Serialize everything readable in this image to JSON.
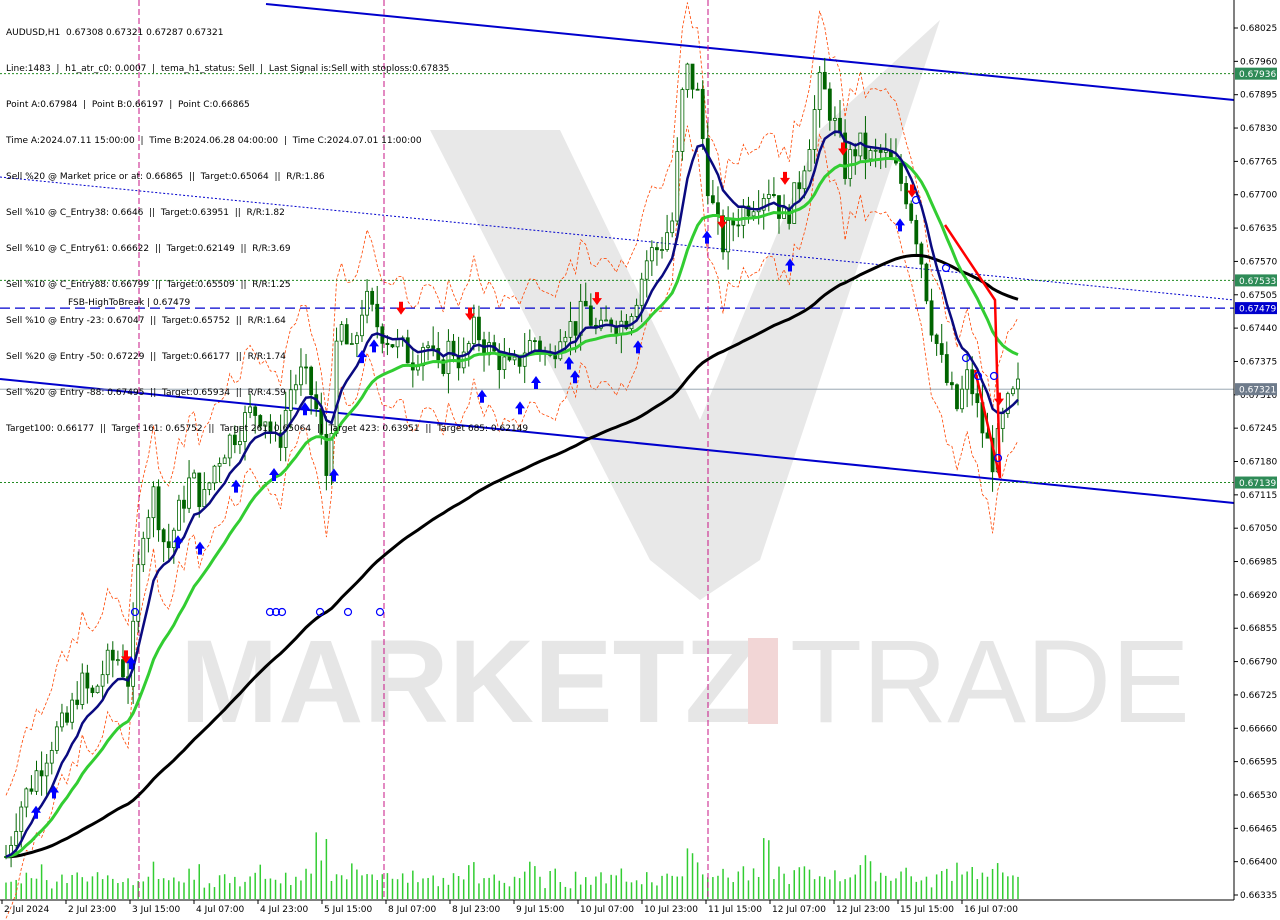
{
  "header": {
    "symbol_line": "AUDUSD,H1  0.67308 0.67321 0.67287 0.67321",
    "info_lines": [
      "Line:1483  |  h1_atr_c0: 0.0007  |  tema_h1_status: Sell  |  Last Signal is:Sell with stoploss:0.67835",
      "Point A:0.67984  |  Point B:0.66197  |  Point C:0.66865",
      "Time A:2024.07.11 15:00:00  |  Time B:2024.06.28 04:00:00  |  Time C:2024.07.01 11:00:00",
      "Sell %20 @ Market price or at: 0.66865  ||  Target:0.65064  ||  R/R:1.86",
      "Sell %10 @ C_Entry38: 0.6646  ||  Target:0.63951  ||  R/R:1.82",
      "Sell %10 @ C_Entry61: 0.66622  ||  Target:0.62149  ||  R/R:3.69",
      "Sell %10 @ C_Entry88: 0.66799  ||  Target:0.65509  ||  R/R:1.25",
      "Sell %10 @ Entry -23: 0.67047  ||  Target:0.65752  ||  R/R:1.64",
      "Sell %20 @ Entry -50: 0.67229  ||  Target:0.66177  ||  R/R:1.74",
      "Sell %20 @ Entry -88: 0.67495  ||  Target:0.65934  ||  R/R:4.59",
      "Target100: 0.66177  ||  Target 161: 0.65752  ||  Target 261: 0.65064  ||  Target 423: 0.63951  ||  Target 685: 0.62149"
    ]
  },
  "watermark": {
    "left": "MARKETZ",
    "right": "TRADE"
  },
  "colors": {
    "candle": "#006400",
    "ema_fast": "#0a0a80",
    "ema_mid": "#32cd32",
    "ema_slow": "#000000",
    "channel": "#0000cd",
    "envelope": "#ff4500",
    "level_green": "#228b22",
    "arrow_buy": "#0000ff",
    "arrow_sell": "#ff0000",
    "session_line": "#c71585",
    "label_green_bg": "#2e8b57",
    "label_blue_bg": "#0000cd",
    "label_gray_bg": "#6e7b8b",
    "volume": "#32cd32"
  },
  "chart_data": {
    "type": "candlestick",
    "symbol": "AUDUSD",
    "timeframe": "H1",
    "ylim": [
      0.66335,
      0.68025
    ],
    "price_ticks": [
      "0.68025",
      "0.67960",
      "0.67895",
      "0.67830",
      "0.67765",
      "0.67700",
      "0.67635",
      "0.67570",
      "0.67505",
      "0.67440",
      "0.67375",
      "0.67310",
      "0.67245",
      "0.67180",
      "0.67115",
      "0.67050",
      "0.66985",
      "0.66920",
      "0.66855",
      "0.66790",
      "0.66725",
      "0.66660",
      "0.66595",
      "0.66530",
      "0.66465",
      "0.66400",
      "0.66335"
    ],
    "time_ticks": [
      "2 Jul 2024",
      "2 Jul 23:00",
      "3 Jul 15:00",
      "4 Jul 07:00",
      "4 Jul 23:00",
      "5 Jul 15:00",
      "8 Jul 07:00",
      "8 Jul 23:00",
      "9 Jul 15:00",
      "10 Jul 07:00",
      "10 Jul 23:00",
      "11 Jul 15:00",
      "12 Jul 07:00",
      "12 Jul 23:00",
      "15 Jul 15:00",
      "16 Jul 07:00"
    ],
    "close_path": [
      0.6641,
      0.665,
      0.6655,
      0.666,
      0.6665,
      0.6667,
      0.6675,
      0.6672,
      0.6678,
      0.668,
      0.6675,
      0.6705,
      0.6712,
      0.67,
      0.6708,
      0.6715,
      0.671,
      0.6718,
      0.6722,
      0.6725,
      0.6728,
      0.6727,
      0.672,
      0.6732,
      0.6735,
      0.673,
      0.6715,
      0.6745,
      0.6738,
      0.675,
      0.6745,
      0.6742,
      0.674,
      0.6738,
      0.6742,
      0.6735,
      0.6741,
      0.6737,
      0.6744,
      0.674,
      0.6738,
      0.6735,
      0.674,
      0.6742,
      0.6737,
      0.6745,
      0.6744,
      0.6748,
      0.6742,
      0.6746,
      0.6745,
      0.675,
      0.6758,
      0.676,
      0.6765,
      0.6795,
      0.679,
      0.677,
      0.676,
      0.6765,
      0.6768,
      0.677,
      0.6772,
      0.6765,
      0.677,
      0.678,
      0.6792,
      0.6785,
      0.6775,
      0.678,
      0.6777,
      0.6778,
      0.6775,
      0.677,
      0.676,
      0.6745,
      0.6735,
      0.6728,
      0.6735,
      0.6725,
      0.6718,
      0.6728,
      0.6732
    ],
    "volume_rel": [
      0.3,
      0.4,
      0.5,
      0.3,
      0.4,
      0.5,
      0.3,
      0.4,
      0.5,
      0.4,
      0.3,
      0.5,
      0.4,
      0.3,
      0.4,
      0.5,
      0.3,
      0.4,
      0.3,
      0.4,
      0.5,
      0.3,
      0.4,
      0.3,
      0.4,
      0.9,
      0.5,
      0.4,
      0.5,
      0.6,
      0.4,
      0.3,
      0.4,
      0.3,
      0.4,
      0.3,
      0.4,
      0.5,
      0.3,
      0.4,
      0.3,
      0.4,
      0.5,
      0.3,
      0.4,
      0.3,
      0.4,
      0.3,
      0.4,
      0.5,
      0.3,
      0.4,
      0.3,
      0.4,
      0.5,
      1.0,
      0.6,
      0.5,
      0.4,
      0.5,
      0.4,
      0.8,
      0.5,
      0.4,
      0.5,
      0.4,
      0.5,
      0.4,
      0.5,
      0.6,
      0.5,
      0.4,
      0.5,
      0.4,
      0.3,
      0.4,
      0.5,
      0.6,
      0.5,
      0.4,
      0.5,
      0.6,
      0.3
    ],
    "price_labels": [
      {
        "price": 0.67936,
        "text": "0.67936",
        "style": "green"
      },
      {
        "price": 0.67533,
        "text": "0.67533",
        "style": "green"
      },
      {
        "price": 0.67479,
        "text": "0.67479",
        "style": "blue"
      },
      {
        "price": 0.67321,
        "text": "0.67321",
        "style": "gray"
      },
      {
        "price": 0.67139,
        "text": "0.67139",
        "style": "green"
      }
    ],
    "annotations": [
      {
        "text": "FSB-HighToBreak  |  0.67479",
        "price": 0.67479
      }
    ]
  }
}
